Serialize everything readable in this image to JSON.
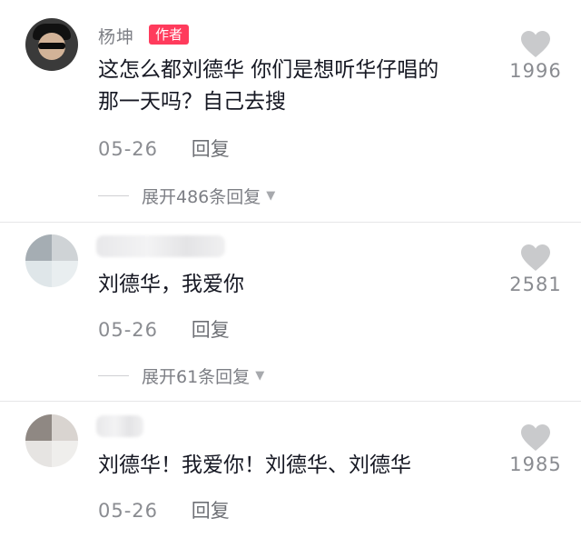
{
  "comments": [
    {
      "username": "杨坤",
      "badge": "作者",
      "text_line1": "这怎么都刘德华 你们是想听华仔唱的",
      "text_line2": "那一天吗？自己去搜",
      "date": "05-26",
      "reply_label": "回复",
      "expand_label": "展开486条回复",
      "likes": "1996"
    },
    {
      "username": "",
      "text_line1": "刘德华，我爱你",
      "date": "05-26",
      "reply_label": "回复",
      "expand_label": "展开61条回复",
      "likes": "2581"
    },
    {
      "username": "",
      "text_line1": "刘德华！我爱你！刘德华、刘德华",
      "date": "05-26",
      "reply_label": "回复",
      "likes": "1985"
    }
  ],
  "colors": {
    "badge": "#ff3b5c",
    "heart": "#c9cacc",
    "text": "#161823",
    "secondary": "#8a8c91"
  }
}
